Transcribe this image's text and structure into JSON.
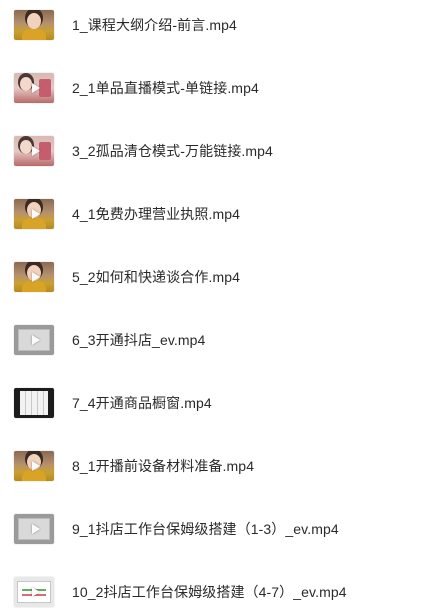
{
  "files": [
    {
      "name": "1_课程大纲介绍-前言.mp4",
      "thumb": "person",
      "play": false
    },
    {
      "name": "2_1单品直播模式-单链接.mp4",
      "thumb": "pink",
      "play": true
    },
    {
      "name": "3_2孤品清仓模式-万能链接.mp4",
      "thumb": "pink",
      "play": true
    },
    {
      "name": "4_1免费办理营业执照.mp4",
      "thumb": "person",
      "play": true
    },
    {
      "name": "5_2如何和快递谈合作.mp4",
      "thumb": "person",
      "play": true
    },
    {
      "name": "6_3开通抖店_ev.mp4",
      "thumb": "screen-gray",
      "play": true
    },
    {
      "name": "7_4开通商品橱窗.mp4",
      "thumb": "screen-dark",
      "play": false
    },
    {
      "name": "8_1开播前设备材料准备.mp4",
      "thumb": "person",
      "play": true
    },
    {
      "name": "9_1抖店工作台保姆级搭建（1-3）_ev.mp4",
      "thumb": "screen-gray",
      "play": true
    },
    {
      "name": "10_2抖店工作台保姆级搭建（4-7）_ev.mp4",
      "thumb": "screen-light",
      "play": true
    }
  ],
  "icon_names": {
    "thumbnail": "video-thumbnail-icon",
    "play": "play-icon"
  }
}
